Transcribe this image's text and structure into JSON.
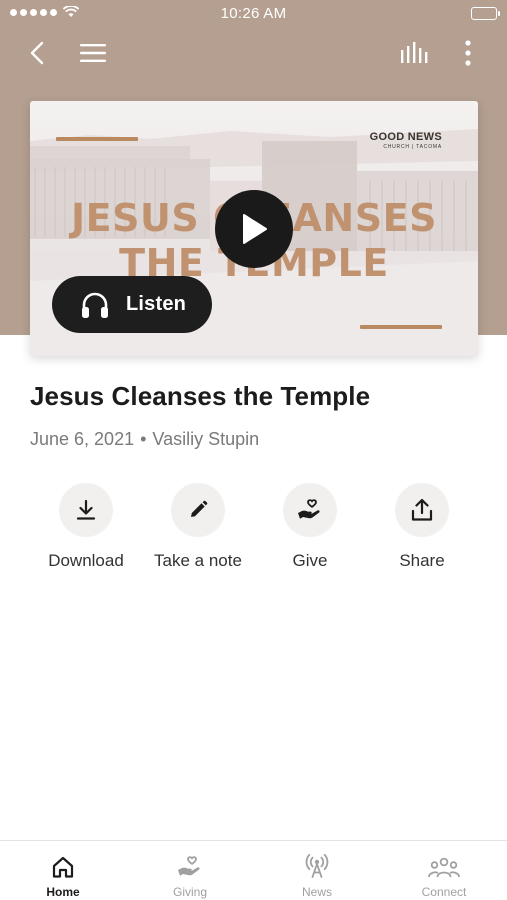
{
  "status_bar": {
    "time": "10:26 AM"
  },
  "nav": {
    "back_icon": "chevron-left-icon",
    "menu_icon": "hamburger-menu-icon",
    "equalizer_icon": "equalizer-icon",
    "more_icon": "vertical-dots-icon"
  },
  "media": {
    "art_title_line1": "JESUS CLEANSES",
    "art_title_line2": "THE TEMPLE",
    "logo_main": "GOOD NEWS",
    "logo_sub": "CHURCH | TACOMA",
    "listen_label": "Listen",
    "accent_color": "#c09270"
  },
  "sermon": {
    "title": "Jesus Cleanses the Temple",
    "date": "June 6, 2021",
    "separator": "•",
    "speaker": "Vasiliy Stupin"
  },
  "actions": [
    {
      "label": "Download",
      "icon": "download-icon"
    },
    {
      "label": "Take a note",
      "icon": "pencil-icon"
    },
    {
      "label": "Give",
      "icon": "heart-hand-icon"
    },
    {
      "label": "Share",
      "icon": "share-icon"
    }
  ],
  "tabs": [
    {
      "label": "Home",
      "icon": "home-icon",
      "active": true
    },
    {
      "label": "Giving",
      "icon": "heart-hand-icon",
      "active": false
    },
    {
      "label": "News",
      "icon": "broadcast-icon",
      "active": false
    },
    {
      "label": "Connect",
      "icon": "people-icon",
      "active": false
    }
  ],
  "colors": {
    "hero_background": "#b49f90",
    "action_circle": "#f1f0ef"
  }
}
